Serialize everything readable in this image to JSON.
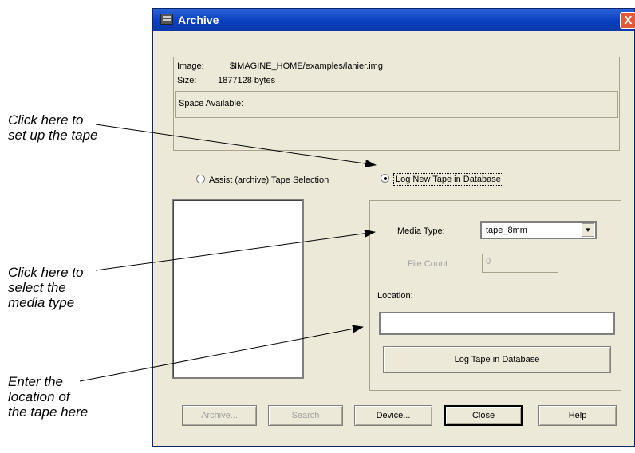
{
  "window": {
    "title": "Archive",
    "close_glyph": "X"
  },
  "info": {
    "image_label": "Image:",
    "image_value": "$IMAGINE_HOME/examples/lanier.img",
    "size_label": "Size:",
    "size_value": "1877128 bytes",
    "space_label": "Space Available:"
  },
  "mode": {
    "options": [
      {
        "label": "Assist (archive) Tape Selection",
        "selected": false
      },
      {
        "label": "Log New Tape in Database",
        "selected": true
      }
    ]
  },
  "tape": {
    "media_type_label": "Media Type:",
    "media_type_value": "tape_8mm",
    "file_count_label": "File Count:",
    "file_count_value": "0",
    "location_label": "Location:",
    "location_value": "",
    "log_button": "Log Tape in Database"
  },
  "buttons": {
    "archive": "Archive...",
    "search": "Search",
    "device": "Device...",
    "close": "Close",
    "help": "Help"
  },
  "annotations": {
    "setup_tape": [
      "Click here to",
      "set up the tape"
    ],
    "media_type": [
      "Click here to",
      "select the",
      "media type"
    ],
    "location": [
      "Enter the",
      "location of",
      "the tape here"
    ]
  },
  "icons": {
    "app": "archive-app-icon",
    "close": "close-icon",
    "dropdown": "chevron-down-icon"
  }
}
